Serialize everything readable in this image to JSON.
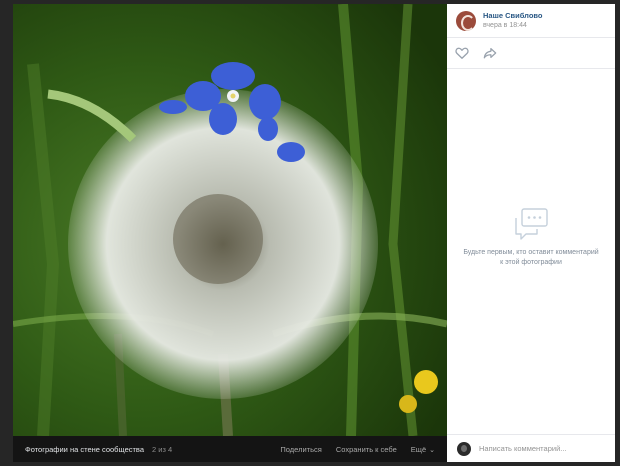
{
  "post": {
    "author_name": "Наше Свиблово",
    "time": "вчера в 18:44"
  },
  "actions": {
    "like_icon": "heart-outline-icon",
    "share_icon": "share-arrow-icon"
  },
  "comments": {
    "empty_text": "Будьте первым, кто оставит комментарий к этой фотографии",
    "input_placeholder": "Написать комментарий..."
  },
  "photo_bar": {
    "album": "Фотографии на стене сообщества",
    "counter": "2 из 4",
    "share": "Поделиться",
    "save": "Сохранить к себе",
    "more": "Ещё"
  },
  "colors": {
    "link": "#2a5885",
    "muted": "#939393",
    "panel_bg": "#ffffff",
    "viewer_bg": "#000000"
  }
}
